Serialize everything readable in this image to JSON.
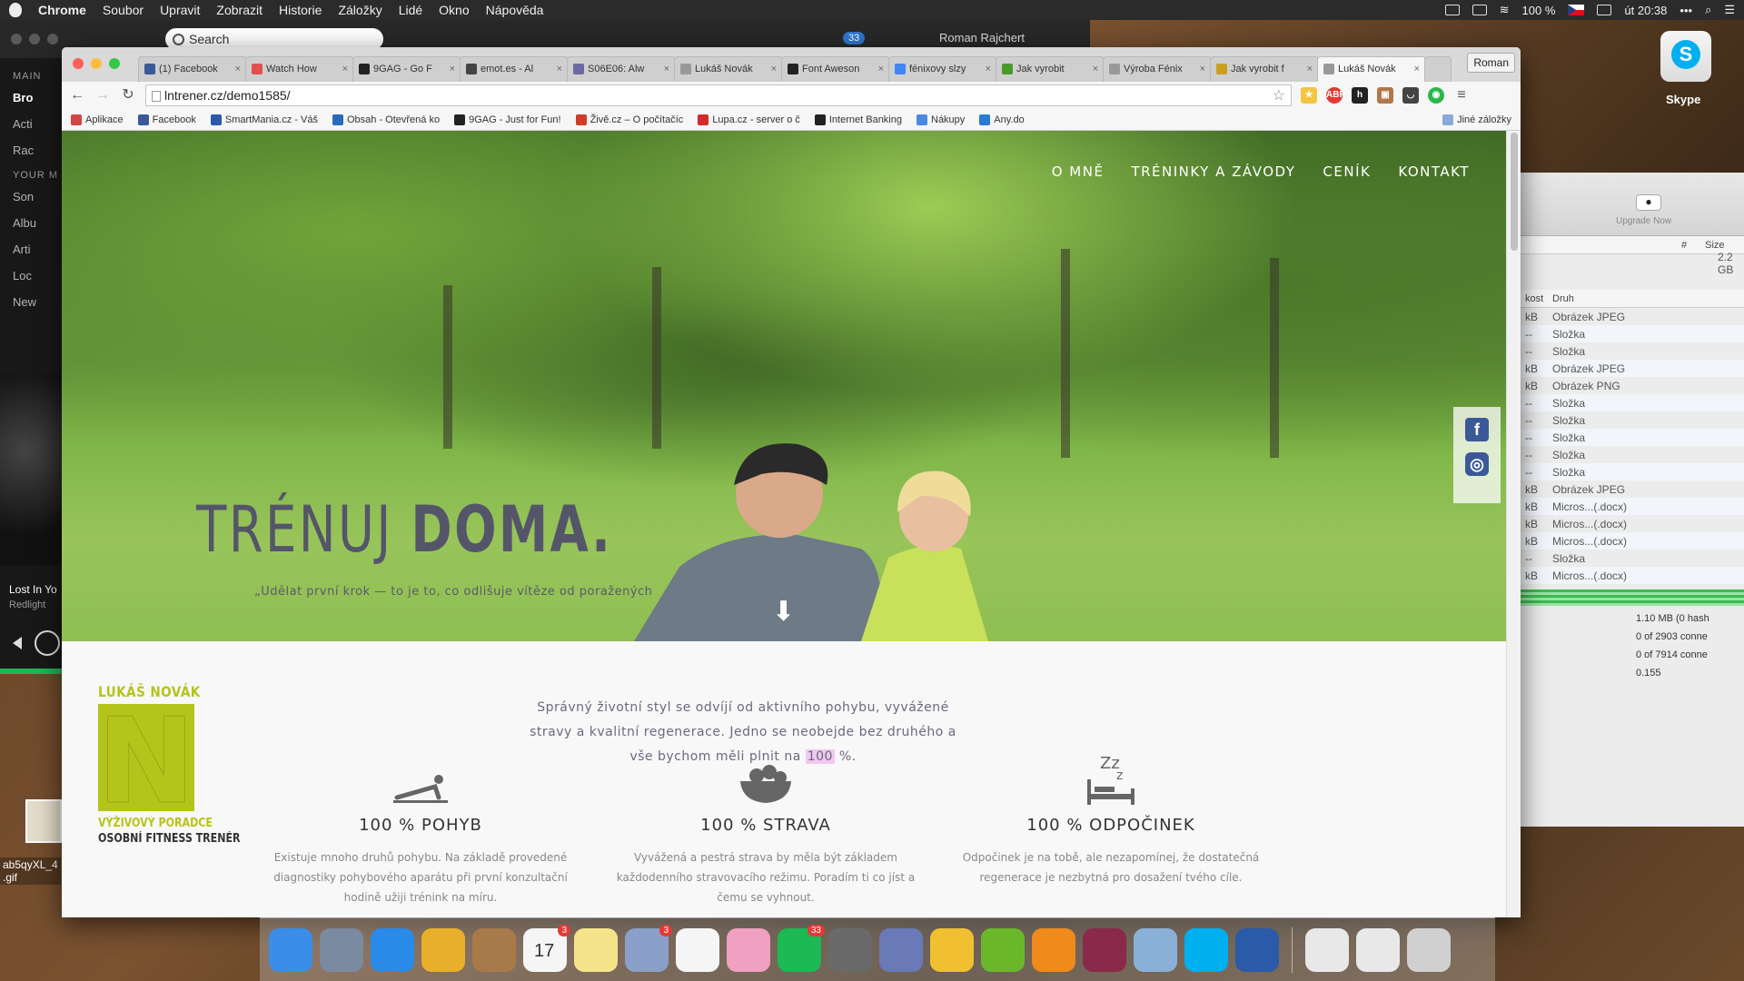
{
  "menubar": {
    "app": "Chrome",
    "items": [
      "Soubor",
      "Upravit",
      "Zobrazit",
      "Historie",
      "Záložky",
      "Lidé",
      "Okno",
      "Nápověda"
    ],
    "battery": "100 %",
    "clock": "út 20:38"
  },
  "spotify": {
    "search_placeholder": "Search",
    "badge": "33",
    "user": "Roman Rajchert",
    "main_label": "MAIN",
    "main_items": [
      "Bro",
      "Acti",
      "Rac"
    ],
    "your_label": "YOUR M",
    "your_items": [
      "Son",
      "Albu",
      "Arti",
      "Loc"
    ],
    "new_label": "New",
    "track": "Lost In Yo",
    "artist": "Redlight"
  },
  "finder": {
    "upgrade": "Upgrade Now",
    "size_header": "Size",
    "hash_header": "#",
    "size_value": "2.2 GB",
    "col_a": "kost",
    "col_b": "Druh",
    "rows": [
      {
        "a": "kB",
        "b": "Obrázek JPEG"
      },
      {
        "a": "--",
        "b": "Složka"
      },
      {
        "a": "--",
        "b": "Složka"
      },
      {
        "a": "kB",
        "b": "Obrázek JPEG"
      },
      {
        "a": "kB",
        "b": "Obrázek PNG"
      },
      {
        "a": "--",
        "b": "Složka"
      },
      {
        "a": "--",
        "b": "Složka"
      },
      {
        "a": "--",
        "b": "Složka"
      },
      {
        "a": "--",
        "b": "Složka"
      },
      {
        "a": "--",
        "b": "Složka"
      },
      {
        "a": "kB",
        "b": "Obrázek JPEG"
      },
      {
        "a": "kB",
        "b": "Micros...(.docx)"
      },
      {
        "a": "kB",
        "b": "Micros...(.docx)"
      },
      {
        "a": "kB",
        "b": "Micros...(.docx)"
      },
      {
        "a": "--",
        "b": "Složka"
      },
      {
        "a": "kB",
        "b": "Micros...(.docx)"
      }
    ],
    "stats": [
      "1.10 MB (0 hash",
      "0 of 2903 conne",
      "0 of 7914 conne",
      "0.155"
    ]
  },
  "desktop": {
    "skype_label": "Skype",
    "file_label": "ab5qyXL_4",
    "file_ext": ".gif"
  },
  "chrome": {
    "tabs": [
      {
        "title": "(1) Facebook",
        "color": "#3b5998"
      },
      {
        "title": "Watch How",
        "color": "#e05050"
      },
      {
        "title": "9GAG - Go F",
        "color": "#222222"
      },
      {
        "title": "emot.es - Al",
        "color": "#444444"
      },
      {
        "title": "S06E06: Alw",
        "color": "#6a6aa0"
      },
      {
        "title": "Lukáš Novák",
        "color": "#999999"
      },
      {
        "title": "Font Aweson",
        "color": "#222222"
      },
      {
        "title": "fénixovy slzy",
        "color": "#4285f4"
      },
      {
        "title": "Jak vyrobit",
        "color": "#4a9a2a"
      },
      {
        "title": "Výroba Fénix",
        "color": "#999999"
      },
      {
        "title": "Jak vyrobit f",
        "color": "#c8a020"
      },
      {
        "title": "Lukáš Novák",
        "color": "#999999"
      }
    ],
    "active_tab": 11,
    "profile": "Roman",
    "url": "lntrener.cz/demo1585/",
    "bookmarks": [
      {
        "label": "Aplikace",
        "color": "#d24545"
      },
      {
        "label": "Facebook",
        "color": "#3b5998"
      },
      {
        "label": "SmartMania.cz - Váš",
        "color": "#2a5aa8"
      },
      {
        "label": "Obsah - Otevřená ko",
        "color": "#2a6ab8"
      },
      {
        "label": "9GAG - Just for Fun!",
        "color": "#222222"
      },
      {
        "label": "Živě.cz – O počítačíc",
        "color": "#d23a2a"
      },
      {
        "label": "Lupa.cz - server o č",
        "color": "#d22a2a"
      },
      {
        "label": "Internet Banking",
        "color": "#222222"
      },
      {
        "label": "Nákupy",
        "color": "#4a8ae0"
      },
      {
        "label": "Any.do",
        "color": "#2a7ad0"
      }
    ],
    "other_bookmarks": "Jiné záložky"
  },
  "site": {
    "nav": [
      "O MNĚ",
      "TRÉNINKY A ZÁVODY",
      "CENÍK",
      "KONTAKT"
    ],
    "hero_title_light": "TRÉNUJ ",
    "hero_title_bold": "DOMA.",
    "hero_quote": "„Udělat první krok — to je to, co odlišuje vítěze od poražených",
    "logo_name": "LUKÁŠ NOVÁK",
    "logo_letter": "N",
    "logo_sub1": "VÝŽIVOVÝ PORADCE",
    "logo_sub2": "OSOBNÍ FITNESS TRENÉR",
    "intro_before": "Správný životní styl se odvíjí od aktivního pohybu, vyvážené stravy a kvalitní regenerace. Jedno se neobejde bez druhého a vše bychom měli plnit na ",
    "intro_hl": "100",
    "intro_after": " %.",
    "features": [
      {
        "icon": "pushup-icon",
        "title": "100 % POHYB",
        "text": "Existuje mnoho druhů pohybu. Na základě provedené diagnostiky pohybového aparátu při první konzultační hodině užiji trénink na míru."
      },
      {
        "icon": "food-bowl-icon",
        "title": "100 % STRAVA",
        "text": "Vyvážená a pestrá strava by měla být základem každodenního stravovacího režimu. Poradím ti co jíst a čemu se vyhnout."
      },
      {
        "icon": "sleep-icon",
        "title": "100 % ODPOČINEK",
        "text": "Odpočinek je na tobě, ale nezapomínej, že dostatečná regenerace je nezbytná pro dosažení tvého cíle."
      }
    ]
  },
  "dock": {
    "apps": [
      {
        "name": "finder",
        "color": "#3a8ee8"
      },
      {
        "name": "launchpad",
        "color": "#7a8aa0"
      },
      {
        "name": "safari",
        "color": "#2a8ae8"
      },
      {
        "name": "chrome",
        "color": "#e8b02a"
      },
      {
        "name": "contacts",
        "color": "#a87a4a"
      },
      {
        "name": "calendar",
        "color": "#f5f5f5",
        "badge": "3",
        "label": "17"
      },
      {
        "name": "notes",
        "color": "#f5e48a"
      },
      {
        "name": "mail-stamp",
        "color": "#8aa0c8",
        "badge": "3"
      },
      {
        "name": "reminders",
        "color": "#f5f5f5"
      },
      {
        "name": "photos",
        "color": "#f0a0c0"
      },
      {
        "name": "spotify",
        "color": "#1db954",
        "badge": "33"
      },
      {
        "name": "system-preferences",
        "color": "#6a6a6a"
      },
      {
        "name": "php",
        "color": "#6a7ab8"
      },
      {
        "name": "cyberduck",
        "color": "#f0c030"
      },
      {
        "name": "utorrent",
        "color": "#6ab82a"
      },
      {
        "name": "vlc",
        "color": "#f08a1a"
      },
      {
        "name": "rar",
        "color": "#8a2a4a"
      },
      {
        "name": "preview",
        "color": "#8ab0d8"
      },
      {
        "name": "skype",
        "color": "#00aff0"
      },
      {
        "name": "word",
        "color": "#2a5aa8"
      },
      {
        "name": "docs-folder",
        "color": "#e8e8e8"
      },
      {
        "name": "downloads",
        "color": "#e8e8e8"
      },
      {
        "name": "trash",
        "color": "#d0d0d0"
      }
    ]
  }
}
